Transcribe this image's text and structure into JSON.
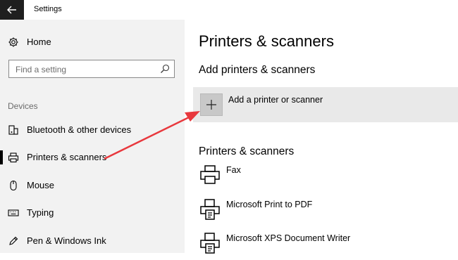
{
  "window": {
    "title": "Settings"
  },
  "sidebar": {
    "home_label": "Home",
    "search_placeholder": "Find a setting",
    "group_header": "Devices",
    "items": [
      {
        "label": "Bluetooth & other devices",
        "icon": "bluetooth-device-icon"
      },
      {
        "label": "Printers & scanners",
        "icon": "printer-icon",
        "selected": true
      },
      {
        "label": "Mouse",
        "icon": "mouse-icon"
      },
      {
        "label": "Typing",
        "icon": "keyboard-icon"
      },
      {
        "label": "Pen & Windows Ink",
        "icon": "pen-icon"
      }
    ]
  },
  "main": {
    "page_title": "Printers & scanners",
    "add_section_title": "Add printers & scanners",
    "add_button_label": "Add a printer or scanner",
    "list_section_title": "Printers & scanners",
    "printers": [
      {
        "name": "Fax"
      },
      {
        "name": "Microsoft Print to PDF"
      },
      {
        "name": "Microsoft XPS Document Writer"
      }
    ]
  },
  "colors": {
    "accent_arrow": "#e8383d",
    "sidebar_bg": "#f2f2f2",
    "selection_bar": "#000000"
  }
}
